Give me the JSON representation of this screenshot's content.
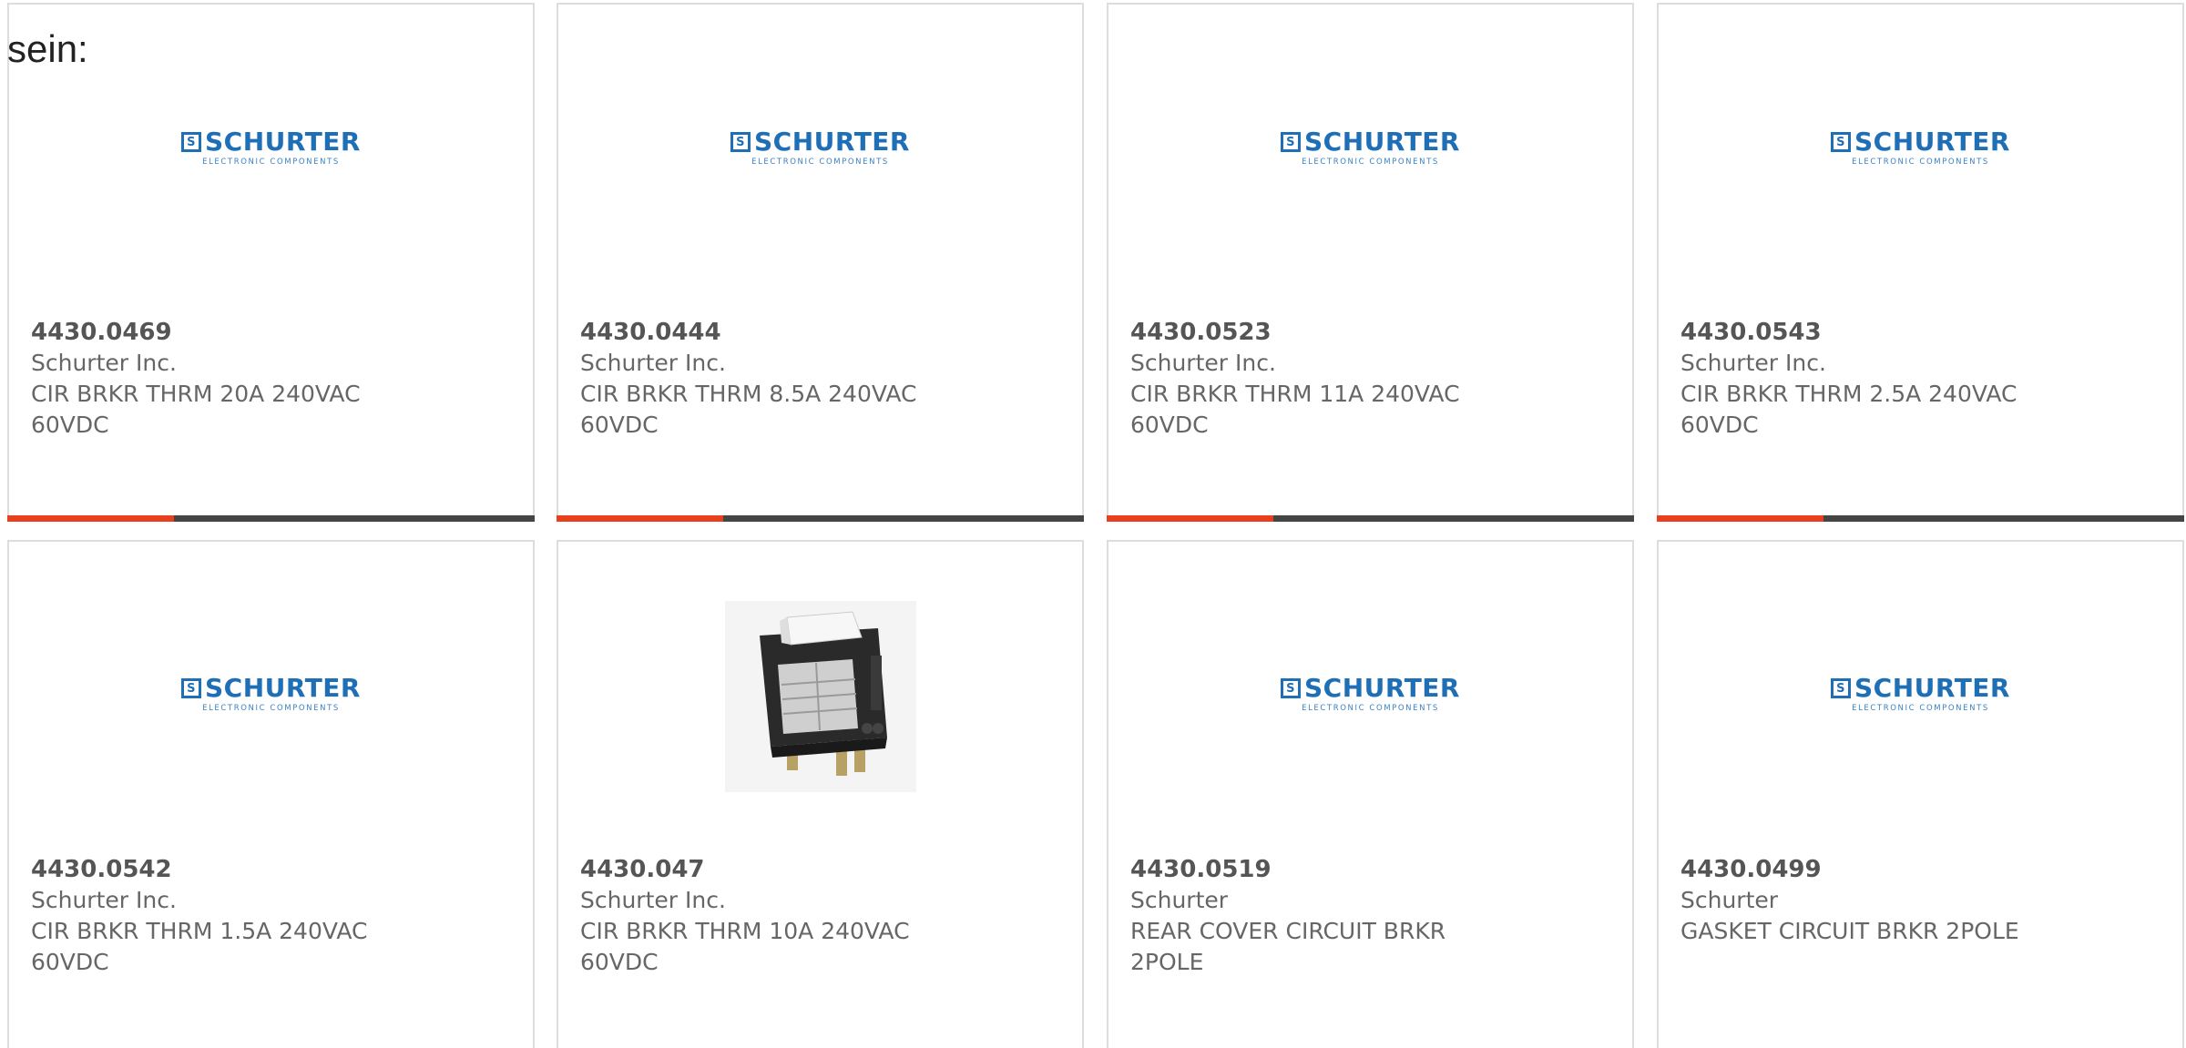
{
  "intro_text": "sein:",
  "colors": {
    "accent": "#e8401c",
    "bar": "#444444",
    "logo_blue": "#1f6fb7",
    "text": "#666666",
    "border": "#dddddd"
  },
  "logo": {
    "mark": "S",
    "name": "SCHURTER",
    "tagline": "ELECTRONIC COMPONENTS"
  },
  "products": [
    {
      "part_number": "4430.0469",
      "manufacturer": "Schurter Inc.",
      "description": "CIR BRKR THRM 20A 240VAC 60VDC",
      "image": "schurter-logo"
    },
    {
      "part_number": "4430.0444",
      "manufacturer": "Schurter Inc.",
      "description": "CIR BRKR THRM 8.5A 240VAC 60VDC",
      "image": "schurter-logo"
    },
    {
      "part_number": "4430.0523",
      "manufacturer": "Schurter Inc.",
      "description": "CIR BRKR THRM 11A 240VAC 60VDC",
      "image": "schurter-logo"
    },
    {
      "part_number": "4430.0543",
      "manufacturer": "Schurter Inc.",
      "description": "CIR BRKR THRM 2.5A 240VAC 60VDC",
      "image": "schurter-logo"
    },
    {
      "part_number": "4430.0542",
      "manufacturer": "Schurter Inc.",
      "description": "CIR BRKR THRM 1.5A 240VAC 60VDC",
      "image": "schurter-logo"
    },
    {
      "part_number": "4430.047",
      "manufacturer": "Schurter Inc.",
      "description": "CIR BRKR THRM 10A 240VAC 60VDC",
      "image": "breaker-photo"
    },
    {
      "part_number": "4430.0519",
      "manufacturer": "Schurter",
      "description": "REAR COVER CIRCUIT BRKR 2POLE",
      "image": "schurter-logo"
    },
    {
      "part_number": "4430.0499",
      "manufacturer": "Schurter",
      "description": "GASKET CIRCUIT BRKR 2POLE",
      "image": "schurter-logo"
    }
  ]
}
